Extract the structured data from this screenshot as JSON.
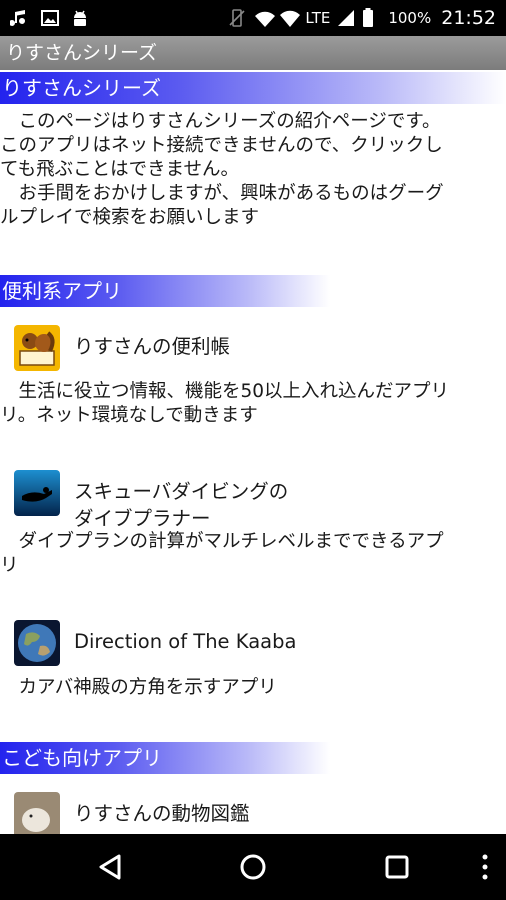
{
  "status_bar": {
    "battery_percent": "100%",
    "time": "21:52",
    "network": "LTE"
  },
  "app_title": "りすさんシリーズ",
  "intro": {
    "header": "りすさんシリーズ",
    "paragraph1": "　このページはりすさんシリーズの紹介ページです。\nこのアプリはネット接続できませんので、クリックし\nても飛ぶことはできません。",
    "paragraph2": "　お手間をおかけしますが、興味があるものはグーグ\nルプレイで検索をお願いします"
  },
  "sections": [
    {
      "header": "便利系アプリ",
      "apps": [
        {
          "icon": "squirrel-notebook-icon",
          "name": "りすさんの便利帳",
          "description": "　生活に役立つ情報、機能を50以上入れ込んだアプリ\nリ。ネット環境なしで動きます"
        },
        {
          "icon": "scuba-diver-icon",
          "name": "スキューバダイビングの\nダイブプラナー",
          "description": "　ダイブプランの計算がマルチレベルまでできるアプ\nリ"
        },
        {
          "icon": "earth-globe-icon",
          "name": "Direction of The Kaaba",
          "description": "　カアバ神殿の方角を示すアプリ"
        }
      ]
    },
    {
      "header": "こども向けアプリ",
      "apps": [
        {
          "icon": "animal-photo-icon",
          "name": "りすさんの動物図鑑"
        }
      ]
    }
  ],
  "colors": {
    "section_header_start": "#2323ee",
    "title_bar": "#8a8a8a"
  }
}
